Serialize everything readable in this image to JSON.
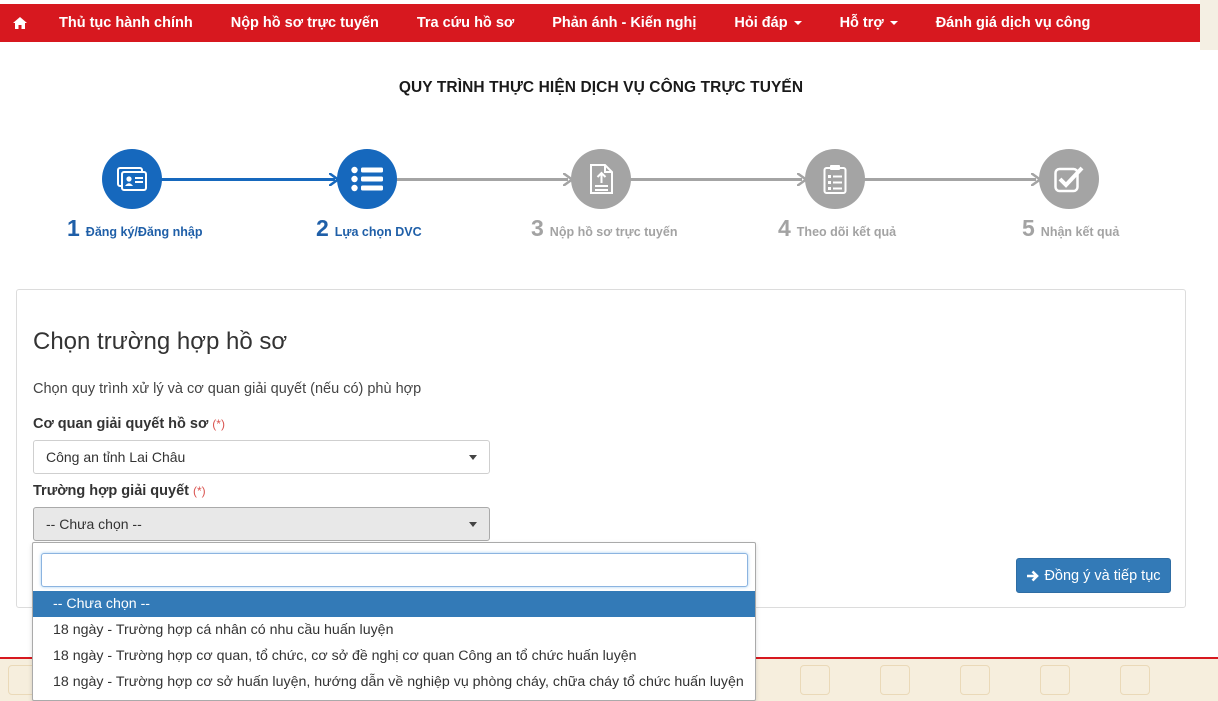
{
  "nav": {
    "items": [
      {
        "label": "Thủ tục hành chính",
        "dropdown": false
      },
      {
        "label": "Nộp hồ sơ trực tuyến",
        "dropdown": false
      },
      {
        "label": "Tra cứu hồ sơ",
        "dropdown": false
      },
      {
        "label": "Phản ánh - Kiến nghị",
        "dropdown": false
      },
      {
        "label": "Hỏi đáp",
        "dropdown": true
      },
      {
        "label": "Hỗ trợ",
        "dropdown": true
      },
      {
        "label": "Đánh giá dịch vụ công",
        "dropdown": false
      }
    ]
  },
  "page_title": "QUY TRÌNH THỰC HIỆN DỊCH VỤ CÔNG TRỰC TUYẾN",
  "steps": [
    {
      "num": "1",
      "label": "Đăng ký/Đăng nhập",
      "icon": "id-card-icon",
      "active": true
    },
    {
      "num": "2",
      "label": "Lựa chọn DVC",
      "icon": "list-icon",
      "active": true
    },
    {
      "num": "3",
      "label": "Nộp hồ sơ trực tuyến",
      "icon": "upload-document-icon",
      "active": false
    },
    {
      "num": "4",
      "label": "Theo dõi kết quả",
      "icon": "clipboard-list-icon",
      "active": false
    },
    {
      "num": "5",
      "label": "Nhận kết quả",
      "icon": "check-square-icon",
      "active": false
    }
  ],
  "form": {
    "heading": "Chọn trường hợp hồ sơ",
    "description": "Chọn quy trình xử lý và cơ quan giải quyết (nếu có) phù hợp",
    "agency_label": "Cơ quan giải quyết hồ sơ",
    "agency_value": "Công an tỉnh Lai Châu",
    "case_label": "Trường hợp giải quyết",
    "case_value": "-- Chưa chọn --",
    "required_mark": "(*)",
    "continue_label": "Đồng ý và tiếp tục"
  },
  "dropdown": {
    "search_value": "",
    "options": [
      "-- Chưa chọn --",
      "18 ngày - Trường hợp cá nhân có nhu cầu huấn luyện",
      "18 ngày - Trường hợp cơ quan, tổ chức, cơ sở đề nghị cơ quan Công an tổ chức huấn luyện",
      "18 ngày - Trường hợp cơ sở huấn luyện, hướng dẫn về nghiệp vụ phòng cháy, chữa cháy tổ chức huấn luyện"
    ],
    "highlighted_index": 0
  },
  "colors": {
    "nav_red": "#d7181f",
    "step_active": "#1668bd",
    "step_inactive": "#a4a4a4",
    "primary_button": "#337ab7"
  }
}
